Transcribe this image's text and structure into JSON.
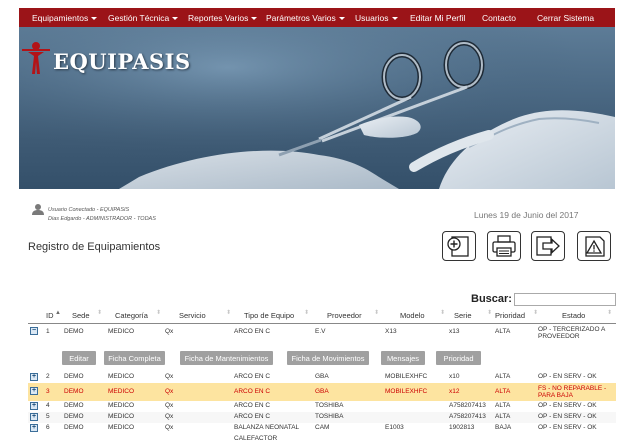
{
  "navbar": {
    "items": [
      {
        "label": "Equipamientos",
        "dropdown": true
      },
      {
        "label": "Gestión Técnica",
        "dropdown": true
      },
      {
        "label": "Reportes Varios",
        "dropdown": true
      },
      {
        "label": "Parámetros Varios",
        "dropdown": true
      },
      {
        "label": "Usuarios",
        "dropdown": true
      },
      {
        "label": "Editar Mi Perfil",
        "dropdown": false
      },
      {
        "label": "Contacto",
        "dropdown": false
      },
      {
        "label": "Cerrar Sistema",
        "dropdown": false
      }
    ]
  },
  "banner": {
    "logo_text": "EQUIPASIS"
  },
  "user": {
    "line1": "Usuario Conectado - EQUIPASIS",
    "line2": "Dias Edgardo - ADMINISTRADOR - TODAS"
  },
  "date": "Lunes 19 de Junio del 2017",
  "page_title": "Registro de Equipamientos",
  "toolbar": {
    "icons": [
      "add-icon",
      "print-icon",
      "export-icon",
      "help-icon"
    ]
  },
  "search": {
    "label": "Buscar:",
    "value": ""
  },
  "table": {
    "columns": [
      "ID",
      "Sede",
      "Categoría",
      "Servicio",
      "Tipo de Equipo",
      "Proveedor",
      "Modelo",
      "Serie",
      "Prioridad",
      "Estado"
    ],
    "rows": [
      {
        "id": "1",
        "sede": "DEMO",
        "categoria": "MEDICO",
        "servicio": "Qx",
        "tipo": "ARCO EN C",
        "proveedor": "E.V",
        "modelo": "X13",
        "serie": "x13",
        "prioridad": "ALTA",
        "estado": "OP - TERCERIZADO A PROVEEDOR",
        "expanded": true
      },
      {
        "id": "2",
        "sede": "DEMO",
        "categoria": "MEDICO",
        "servicio": "Qx",
        "tipo": "ARCO EN C",
        "proveedor": "GBA",
        "modelo": "MOBILEXHFC",
        "serie": "x10",
        "prioridad": "ALTA",
        "estado": "OP - EN SERV - OK"
      },
      {
        "id": "3",
        "sede": "DEMO",
        "categoria": "MEDICO",
        "servicio": "Qx",
        "tipo": "ARCO EN C",
        "proveedor": "GBA",
        "modelo": "MOBILEXHFC",
        "serie": "x12",
        "prioridad": "ALTA",
        "estado": "FS - NO REPARABLE - PARA BAJA",
        "highlight": true
      },
      {
        "id": "4",
        "sede": "DEMO",
        "categoria": "MEDICO",
        "servicio": "Qx",
        "tipo": "ARCO EN C",
        "proveedor": "TOSHIBA",
        "modelo": "",
        "serie": "A758207413",
        "prioridad": "ALTA",
        "estado": "OP - EN SERV - OK"
      },
      {
        "id": "5",
        "sede": "DEMO",
        "categoria": "MEDICO",
        "servicio": "Qx",
        "tipo": "ARCO EN C",
        "proveedor": "TOSHIBA",
        "modelo": "",
        "serie": "A758207413",
        "prioridad": "ALTA",
        "estado": "OP - EN SERV - OK"
      },
      {
        "id": "6",
        "sede": "DEMO",
        "categoria": "MEDICO",
        "servicio": "Qx",
        "tipo": "BALANZA NEONATAL",
        "proveedor": "CAM",
        "modelo": "E1003",
        "serie": "1902813",
        "prioridad": "BAJA",
        "estado": "OP - EN SERV - OK"
      },
      {
        "id": "",
        "sede": "",
        "categoria": "",
        "servicio": "",
        "tipo": "CALEFACTOR",
        "proveedor": "",
        "modelo": "",
        "serie": "",
        "prioridad": "",
        "estado": ""
      }
    ],
    "actions": [
      "Editar",
      "Ficha Completa",
      "Ficha de Mantenimientos",
      "Ficha de Movimientos",
      "Mensajes",
      "Prioridad"
    ]
  },
  "colors": {
    "navbar": "#9b1418",
    "highlight_row": "#fde4a0",
    "highlight_text": "#cc0000",
    "action_button": "#a0a0a0"
  }
}
